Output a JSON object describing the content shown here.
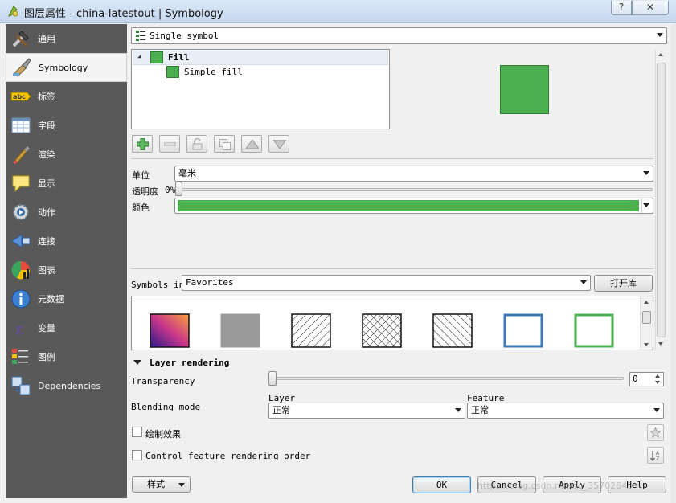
{
  "window": {
    "title": "图层属性 - china-latestout | Symbology",
    "help_label": "?",
    "close_label": "✕"
  },
  "sidebar": {
    "items": [
      {
        "label": "通用",
        "icon": "wrench-hammer-icon"
      },
      {
        "label": "Symbology",
        "icon": "paintbrush-icon"
      },
      {
        "label": "标签",
        "icon": "abc-label-icon"
      },
      {
        "label": "字段",
        "icon": "table-fields-icon"
      },
      {
        "label": "渲染",
        "icon": "brush-render-icon"
      },
      {
        "label": "显示",
        "icon": "speech-bubble-icon"
      },
      {
        "label": "动作",
        "icon": "gear-action-icon"
      },
      {
        "label": "连接",
        "icon": "join-icon"
      },
      {
        "label": "图表",
        "icon": "diagram-icon"
      },
      {
        "label": "元数据",
        "icon": "info-icon"
      },
      {
        "label": "变量",
        "icon": "epsilon-icon"
      },
      {
        "label": "图例",
        "icon": "legend-icon"
      },
      {
        "label": "Dependencies",
        "icon": "dependencies-icon"
      }
    ],
    "active_index": 1
  },
  "renderer": {
    "value": "Single symbol"
  },
  "symbol_tree": {
    "root": "Fill",
    "child": "Simple fill",
    "expand_glyph": "◢"
  },
  "props": {
    "unit_label": "单位",
    "unit_value": "毫米",
    "opacity_label": "透明度",
    "opacity_value": "0%",
    "color_label": "颜色"
  },
  "symbols": {
    "label": "Symbols in",
    "library": "Favorites",
    "open_library": "打开库"
  },
  "layer_rendering": {
    "title": "Layer rendering",
    "transparency_label": "Transparency",
    "transparency_value": "0",
    "blending_label": "Blending mode",
    "layer_label": "Layer",
    "feature_label": "Feature",
    "layer_blend": "正常",
    "feature_blend": "正常",
    "draw_effects_label": "绘制效果",
    "control_order_label": "Control feature rendering order"
  },
  "footer": {
    "style_label": "样式",
    "ok_label": "OK",
    "cancel_label": "Cancel",
    "apply_label": "Apply",
    "help_label": "Help",
    "watermark": "https://blog.csdn.net/qq_35702643"
  },
  "colors": {
    "symbol_fill": "#4caf50",
    "symbol_stroke": "#2e7d32",
    "sidebar_bg": "#595959",
    "outline_blue": "#3d7ab5",
    "outline_green": "#4caf50"
  }
}
